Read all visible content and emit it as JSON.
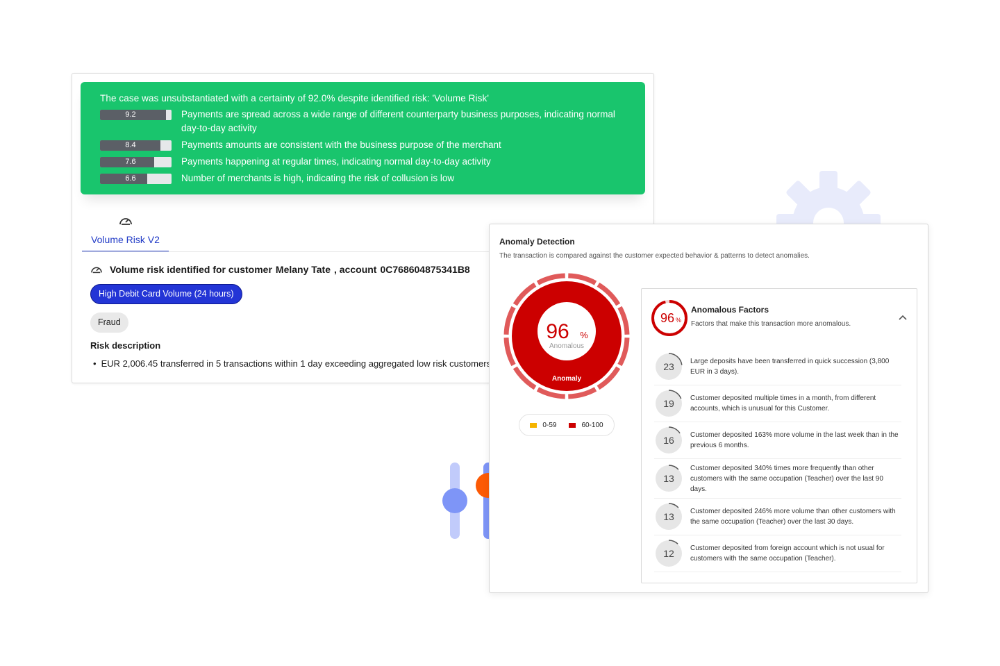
{
  "case_summary": {
    "title": "The case was unsubstantiated with a certainty of 92.0% despite identified risk: 'Volume Risk'",
    "factors": [
      {
        "score": "9.2",
        "value": 9.2,
        "text": "Payments are spread across a wide range of different counterparty business purposes, indicating normal day-to-day activity"
      },
      {
        "score": "8.4",
        "value": 8.4,
        "text": "Payments amounts are consistent with the business purpose of the merchant"
      },
      {
        "score": "7.6",
        "value": 7.6,
        "text": "Payments happening at regular times, indicating normal day-to-day activity"
      },
      {
        "score": "6.6",
        "value": 6.6,
        "text": "Number of merchants is high, indicating the risk of collusion is low"
      }
    ]
  },
  "tab": {
    "label": "Volume Risk V2",
    "icon": "gauge-icon"
  },
  "risk": {
    "heading_prefix": "Volume risk identified for customer",
    "customer": "Melany Tate",
    "account_prefix": ", account",
    "account": "0C768604875341B8",
    "tag_primary": "High Debit Card Volume (24 hours)",
    "tag_secondary": "Fraud",
    "description_label": "Risk description",
    "description": "EUR 2,006.45 transferred in 5 transactions within 1 day exceeding aggregated low risk customers"
  },
  "anomaly": {
    "title": "Anomaly Detection",
    "subtitle": "The transaction is compared against the customer expected behavior & patterns to detect anomalies.",
    "score": "96",
    "score_unit": "%",
    "score_value": 96,
    "score_caption": "Anomalous",
    "ring_label": "Anomaly",
    "legend": [
      {
        "label": "0-59",
        "color": "#f5b400"
      },
      {
        "label": "60-100",
        "color": "#cc0000"
      }
    ],
    "colors": {
      "primary": "#cc0000",
      "ring": "#e05a5a"
    },
    "factors_header": {
      "score": "96",
      "unit": "%",
      "title": "Anomalous Factors",
      "subtitle": "Factors that make this transaction more anomalous."
    },
    "factors": [
      {
        "score": "23",
        "value": 23,
        "text": "Large deposits have been transferred in quick succession (3,800 EUR in 3 days)."
      },
      {
        "score": "19",
        "value": 19,
        "text": "Customer deposited multiple times in a month, from different accounts, which is unusual for this Customer."
      },
      {
        "score": "16",
        "value": 16,
        "text": "Customer deposited 163% more volume in the last week than in the previous 6 months."
      },
      {
        "score": "13",
        "value": 13,
        "text": "Customer deposited 340% times more frequently than other customers with the same occupation (Teacher) over the last 90 days."
      },
      {
        "score": "13",
        "value": 13,
        "text": "Customer deposited 246% more volume than other customers with the same occupation (Teacher) over the last 30 days."
      },
      {
        "score": "12",
        "value": 12,
        "text": "Customer deposited from foreign account which is not usual for customers with the same occupation (Teacher)."
      }
    ]
  }
}
